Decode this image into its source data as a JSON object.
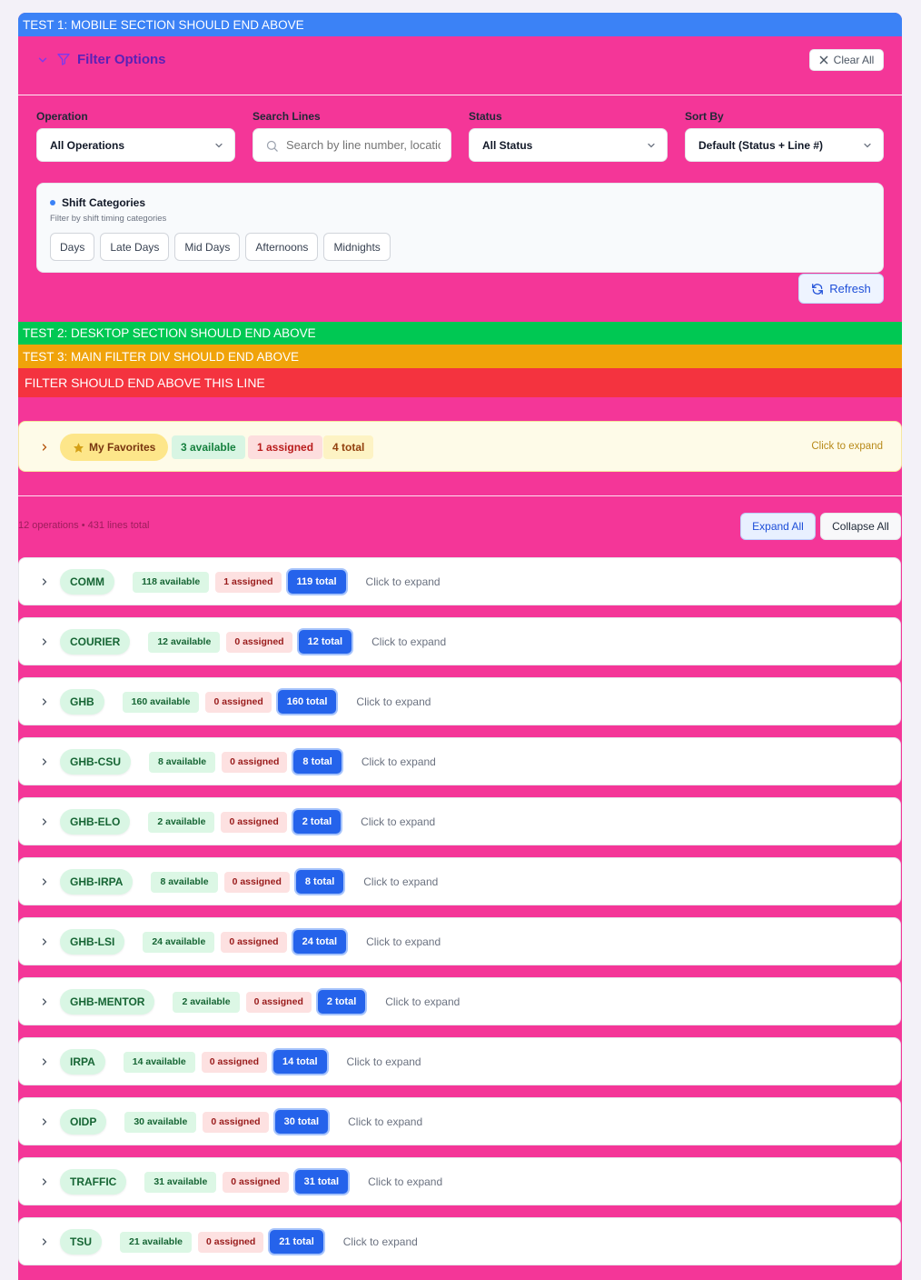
{
  "tests": {
    "t1": "TEST 1: MOBILE SECTION SHOULD END ABOVE",
    "t2": "TEST 2: DESKTOP SECTION SHOULD END ABOVE",
    "t3": "TEST 3: MAIN FILTER DIV SHOULD END ABOVE",
    "t4": "FILTER SHOULD END ABOVE THIS LINE"
  },
  "filter": {
    "title": "Filter Options",
    "clear_all": "Clear All",
    "operation_label": "Operation",
    "operation_value": "All Operations",
    "search_label": "Search Lines",
    "search_placeholder": "Search by line number, location...",
    "status_label": "Status",
    "status_value": "All Status",
    "sort_label": "Sort By",
    "sort_value": "Default (Status + Line #)",
    "shift_title": "Shift Categories",
    "shift_subtitle": "Filter by shift timing categories",
    "shift_chips": [
      "Days",
      "Late Days",
      "Mid Days",
      "Afternoons",
      "Midnights"
    ],
    "refresh": "Refresh"
  },
  "favorites": {
    "label": "My Favorites",
    "available": "3 available",
    "assigned": "1 assigned",
    "total": "4 total",
    "expand_hint": "Click to expand"
  },
  "summary": "12 operations • 431 lines total",
  "expand_all": "Expand All",
  "collapse_all": "Collapse All",
  "expand_hint": "Click to expand",
  "operations": [
    {
      "name": "COMM",
      "available": "118 available",
      "assigned": "1 assigned",
      "total": "119 total"
    },
    {
      "name": "COURIER",
      "available": "12 available",
      "assigned": "0 assigned",
      "total": "12 total"
    },
    {
      "name": "GHB",
      "available": "160 available",
      "assigned": "0 assigned",
      "total": "160 total"
    },
    {
      "name": "GHB-CSU",
      "available": "8 available",
      "assigned": "0 assigned",
      "total": "8 total"
    },
    {
      "name": "GHB-ELO",
      "available": "2 available",
      "assigned": "0 assigned",
      "total": "2 total"
    },
    {
      "name": "GHB-IRPA",
      "available": "8 available",
      "assigned": "0 assigned",
      "total": "8 total"
    },
    {
      "name": "GHB-LSI",
      "available": "24 available",
      "assigned": "0 assigned",
      "total": "24 total"
    },
    {
      "name": "GHB-MENTOR",
      "available": "2 available",
      "assigned": "0 assigned",
      "total": "2 total"
    },
    {
      "name": "IRPA",
      "available": "14 available",
      "assigned": "0 assigned",
      "total": "14 total"
    },
    {
      "name": "OIDP",
      "available": "30 available",
      "assigned": "0 assigned",
      "total": "30 total"
    },
    {
      "name": "TRAFFIC",
      "available": "31 available",
      "assigned": "0 assigned",
      "total": "31 total"
    },
    {
      "name": "TSU",
      "available": "21 available",
      "assigned": "0 assigned",
      "total": "21 total"
    }
  ],
  "colors": {
    "page_pink": "#f43698",
    "accent_blue": "#2563eb",
    "available_green": "#166534",
    "assigned_red": "#991b1b"
  }
}
